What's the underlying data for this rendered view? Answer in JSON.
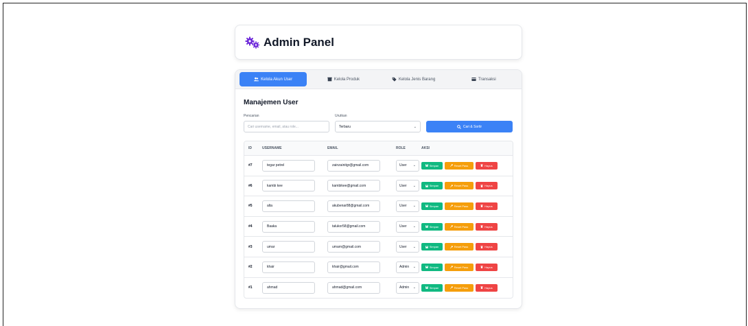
{
  "header": {
    "title": "Admin Panel",
    "icon": "gears-icon",
    "icon_color": "#6d28d9"
  },
  "tabs": [
    {
      "label": "Kelola Akun User",
      "icon": "users-icon",
      "active": true
    },
    {
      "label": "Kelola Produk",
      "icon": "box-icon",
      "active": false
    },
    {
      "label": "Kelola Jenis Barang",
      "icon": "tag-icon",
      "active": false
    },
    {
      "label": "Transaksi",
      "icon": "receipt-icon",
      "active": false
    }
  ],
  "section": {
    "title": "Manajemen User"
  },
  "filters": {
    "search_label": "Pencarian",
    "search_placeholder": "Cari username, email, atau role...",
    "sort_label": "Urutkan",
    "sort_value": "Terbaru",
    "search_button": "Cari & Sortir"
  },
  "table": {
    "headers": {
      "id": "ID",
      "username": "USERNAME",
      "email": "EMAIL",
      "role": "ROLE",
      "actions": "AKSI"
    },
    "rows": [
      {
        "id": "#7",
        "username": "tegar petrel",
        "email": "zainzainitgr@gmail.com",
        "role": "User"
      },
      {
        "id": "#6",
        "username": "kambi kee",
        "email": "kambikee@gmail.com",
        "role": "User"
      },
      {
        "id": "#5",
        "username": "alta",
        "email": "akubenar88@gmail.com",
        "role": "User"
      },
      {
        "id": "#4",
        "username": "Baaka",
        "email": "talukor58@gmail.com",
        "role": "User"
      },
      {
        "id": "#3",
        "username": "umar",
        "email": "umarn@gmail.com",
        "role": "User"
      },
      {
        "id": "#2",
        "username": "khair",
        "email": "khair@gmail.com",
        "role": "Admin"
      },
      {
        "id": "#1",
        "username": "ahmad",
        "email": "ahmad@gmail.com",
        "role": "Admin"
      }
    ],
    "actions": {
      "save": "Simpan",
      "reset": "Reset Pass",
      "delete": "Hapus"
    }
  },
  "colors": {
    "primary": "#3b82f6",
    "save": "#10b981",
    "reset": "#f59e0b",
    "delete": "#ef4444"
  }
}
